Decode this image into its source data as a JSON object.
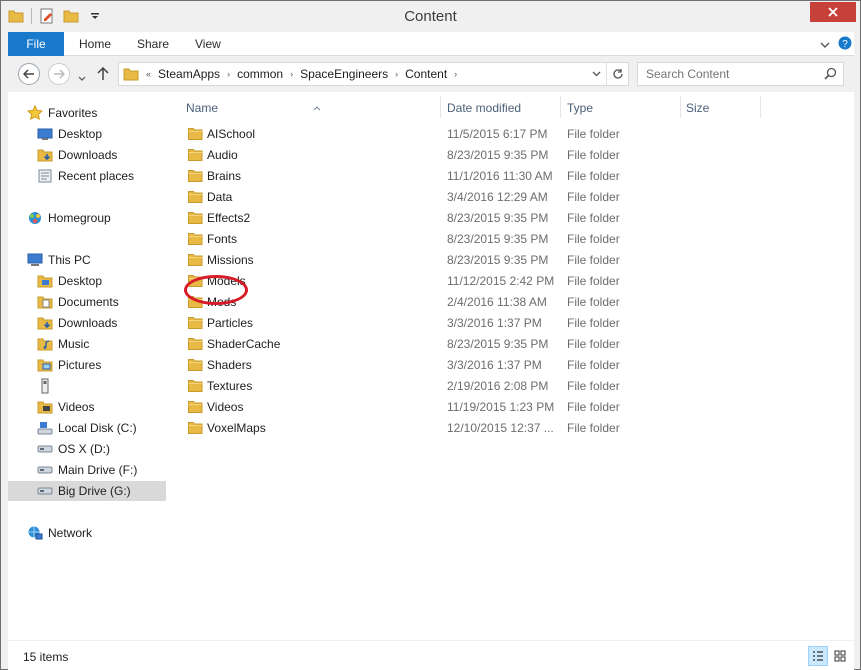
{
  "window": {
    "title": "Content"
  },
  "ribbon": {
    "tabs": [
      {
        "label": "File",
        "active": true
      },
      {
        "label": "Home"
      },
      {
        "label": "Share"
      },
      {
        "label": "View"
      }
    ]
  },
  "address": {
    "overflow": "«",
    "crumbs": [
      "SteamApps",
      "common",
      "SpaceEngineers",
      "Content"
    ]
  },
  "search": {
    "placeholder": "Search Content"
  },
  "nav": {
    "favorites": "Favorites",
    "favorites_items": [
      "Desktop",
      "Downloads",
      "Recent places"
    ],
    "homegroup": "Homegroup",
    "this_pc": "This PC",
    "pc_items": [
      "Desktop",
      "Documents",
      "Downloads",
      "Music",
      "Pictures",
      "",
      "Videos",
      "Local Disk (C:)",
      "OS X (D:)",
      "Main Drive (F:)",
      "Big Drive (G:)"
    ],
    "network": "Network"
  },
  "columns": {
    "name": "Name",
    "date": "Date modified",
    "type": "Type",
    "size": "Size"
  },
  "files": [
    {
      "name": "AISchool",
      "date": "11/5/2015 6:17 PM",
      "type": "File folder"
    },
    {
      "name": "Audio",
      "date": "8/23/2015 9:35 PM",
      "type": "File folder"
    },
    {
      "name": "Brains",
      "date": "11/1/2016 11:30 AM",
      "type": "File folder"
    },
    {
      "name": "Data",
      "date": "3/4/2016 12:29 AM",
      "type": "File folder"
    },
    {
      "name": "Effects2",
      "date": "8/23/2015 9:35 PM",
      "type": "File folder"
    },
    {
      "name": "Fonts",
      "date": "8/23/2015 9:35 PM",
      "type": "File folder"
    },
    {
      "name": "Missions",
      "date": "8/23/2015 9:35 PM",
      "type": "File folder"
    },
    {
      "name": "Models",
      "date": "11/12/2015 2:42 PM",
      "type": "File folder"
    },
    {
      "name": "Mods",
      "date": "2/4/2016 11:38 AM",
      "type": "File folder"
    },
    {
      "name": "Particles",
      "date": "3/3/2016 1:37 PM",
      "type": "File folder"
    },
    {
      "name": "ShaderCache",
      "date": "8/23/2015 9:35 PM",
      "type": "File folder"
    },
    {
      "name": "Shaders",
      "date": "3/3/2016 1:37 PM",
      "type": "File folder"
    },
    {
      "name": "Textures",
      "date": "2/19/2016 2:08 PM",
      "type": "File folder"
    },
    {
      "name": "Videos",
      "date": "11/19/2015 1:23 PM",
      "type": "File folder"
    },
    {
      "name": "VoxelMaps",
      "date": "12/10/2015 12:37 ...",
      "type": "File folder"
    }
  ],
  "status": {
    "item_count": "15 items"
  },
  "colors": {
    "accent": "#1979ca",
    "close": "#c7413a",
    "highlight_circle": "#d71c28",
    "folder": "#e8b945"
  }
}
